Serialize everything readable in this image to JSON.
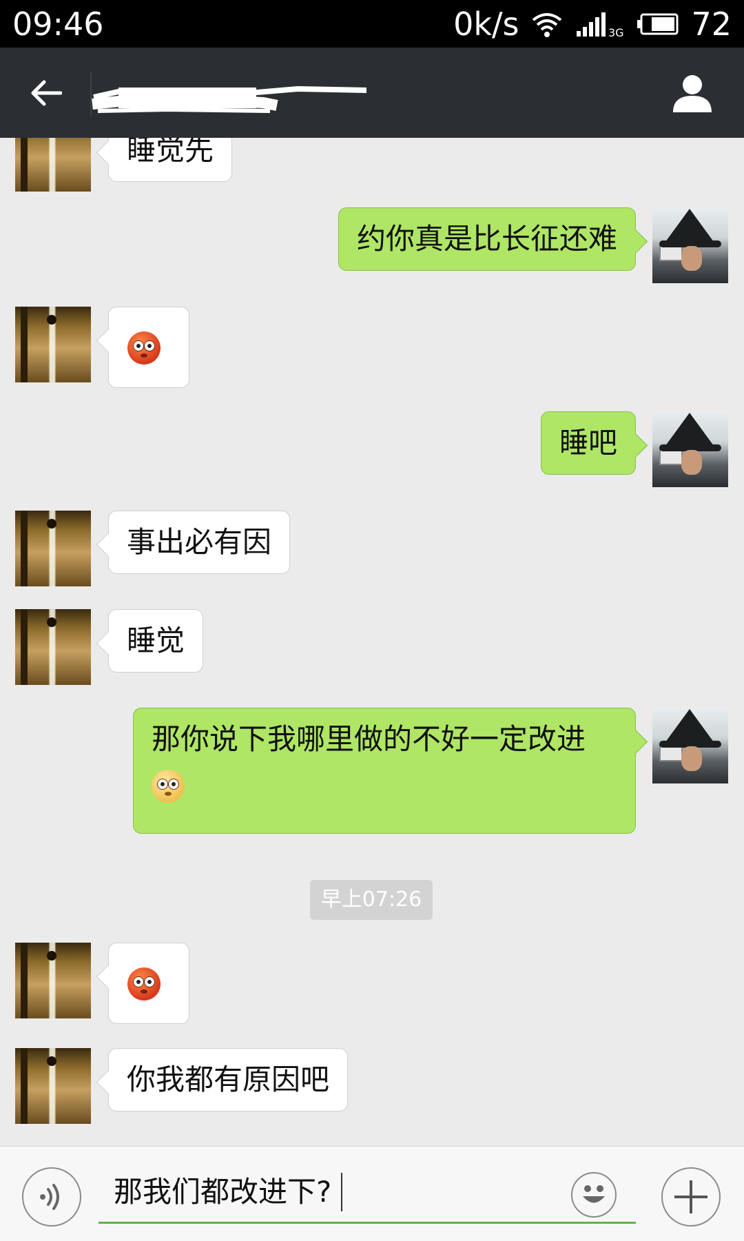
{
  "status_bar": {
    "time": "09:46",
    "net_speed": "0k/s",
    "network_type": "3G",
    "battery": "72",
    "icons": [
      "wifi-icon",
      "signal-icon",
      "battery-icon"
    ]
  },
  "header": {
    "contact_name": "",
    "icons": [
      "back-arrow-icon",
      "profile-icon"
    ]
  },
  "messages": [
    {
      "side": "in",
      "text": "睡觉先"
    },
    {
      "side": "out",
      "text": "约你真是比长征还难"
    },
    {
      "side": "in",
      "emoji": "flushed-face-emoji"
    },
    {
      "side": "out",
      "text": "睡吧"
    },
    {
      "side": "in",
      "text": "事出必有因"
    },
    {
      "side": "in",
      "text": "睡觉"
    },
    {
      "side": "out",
      "text": "那你说下我哪里做的不好一定改进",
      "emoji": "worried-face-emoji"
    },
    {
      "side": "timestamp",
      "text": "早上07:26"
    },
    {
      "side": "in",
      "emoji": "flushed-face-emoji"
    },
    {
      "side": "in",
      "text": "你我都有原因吧"
    }
  ],
  "input_bar": {
    "draft_text": "那我们都改进下?",
    "icons": [
      "voice-icon",
      "emoji-icon",
      "plus-icon"
    ]
  },
  "colors": {
    "header_bg": "#2b2f33",
    "chat_bg": "#ebebeb",
    "outgoing_bubble": "#afe665",
    "incoming_bubble": "#ffffff",
    "input_underline": "#62b24a"
  }
}
